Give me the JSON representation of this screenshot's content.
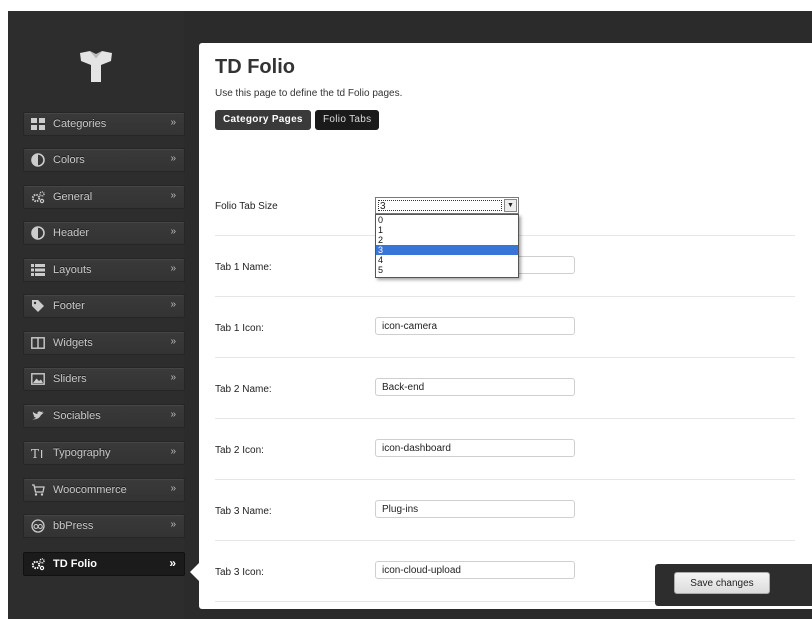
{
  "sidebar": {
    "items": [
      {
        "label": "Categories",
        "icon": "grid-icon"
      },
      {
        "label": "Colors",
        "icon": "contrast-icon"
      },
      {
        "label": "General",
        "icon": "gears-icon"
      },
      {
        "label": "Header",
        "icon": "contrast-icon"
      },
      {
        "label": "Layouts",
        "icon": "list-icon"
      },
      {
        "label": "Footer",
        "icon": "tag-icon"
      },
      {
        "label": "Widgets",
        "icon": "columns-icon"
      },
      {
        "label": "Sliders",
        "icon": "image-icon"
      },
      {
        "label": "Sociables",
        "icon": "twitter-bird-icon"
      },
      {
        "label": "Typography",
        "icon": "text-icon"
      },
      {
        "label": "Woocommerce",
        "icon": "cart-icon"
      },
      {
        "label": "bbPress",
        "icon": "bbpress-icon"
      },
      {
        "label": "TD Folio",
        "icon": "gears-icon",
        "active": true
      }
    ],
    "chevron": "»"
  },
  "main": {
    "title": "TD Folio",
    "subtitle": "Use this page to define the td Folio pages.",
    "tabs": [
      {
        "label": "Category Pages"
      },
      {
        "label": "Folio Tabs"
      }
    ],
    "fields": {
      "tab_size_label": "Folio Tab Size",
      "tab_size_value": "3",
      "tab_size_options": [
        "0",
        "1",
        "2",
        "3",
        "4",
        "5"
      ],
      "tab1_name_label": "Tab 1 Name:",
      "tab1_name_value": "",
      "tab1_icon_label": "Tab 1 Icon:",
      "tab1_icon_value": "icon-camera",
      "tab2_name_label": "Tab 2 Name:",
      "tab2_name_value": "Back-end",
      "tab2_icon_label": "Tab 2 Icon:",
      "tab2_icon_value": "icon-dashboard",
      "tab3_name_label": "Tab 3 Name:",
      "tab3_name_value": "Plug-ins",
      "tab3_icon_label": "Tab 3 Icon:",
      "tab3_icon_value": "icon-cloud-upload"
    },
    "save_label": "Save changes"
  },
  "colors": {
    "sidebar_bg": "#2d2d2d",
    "selected_option": "#3875d7"
  }
}
